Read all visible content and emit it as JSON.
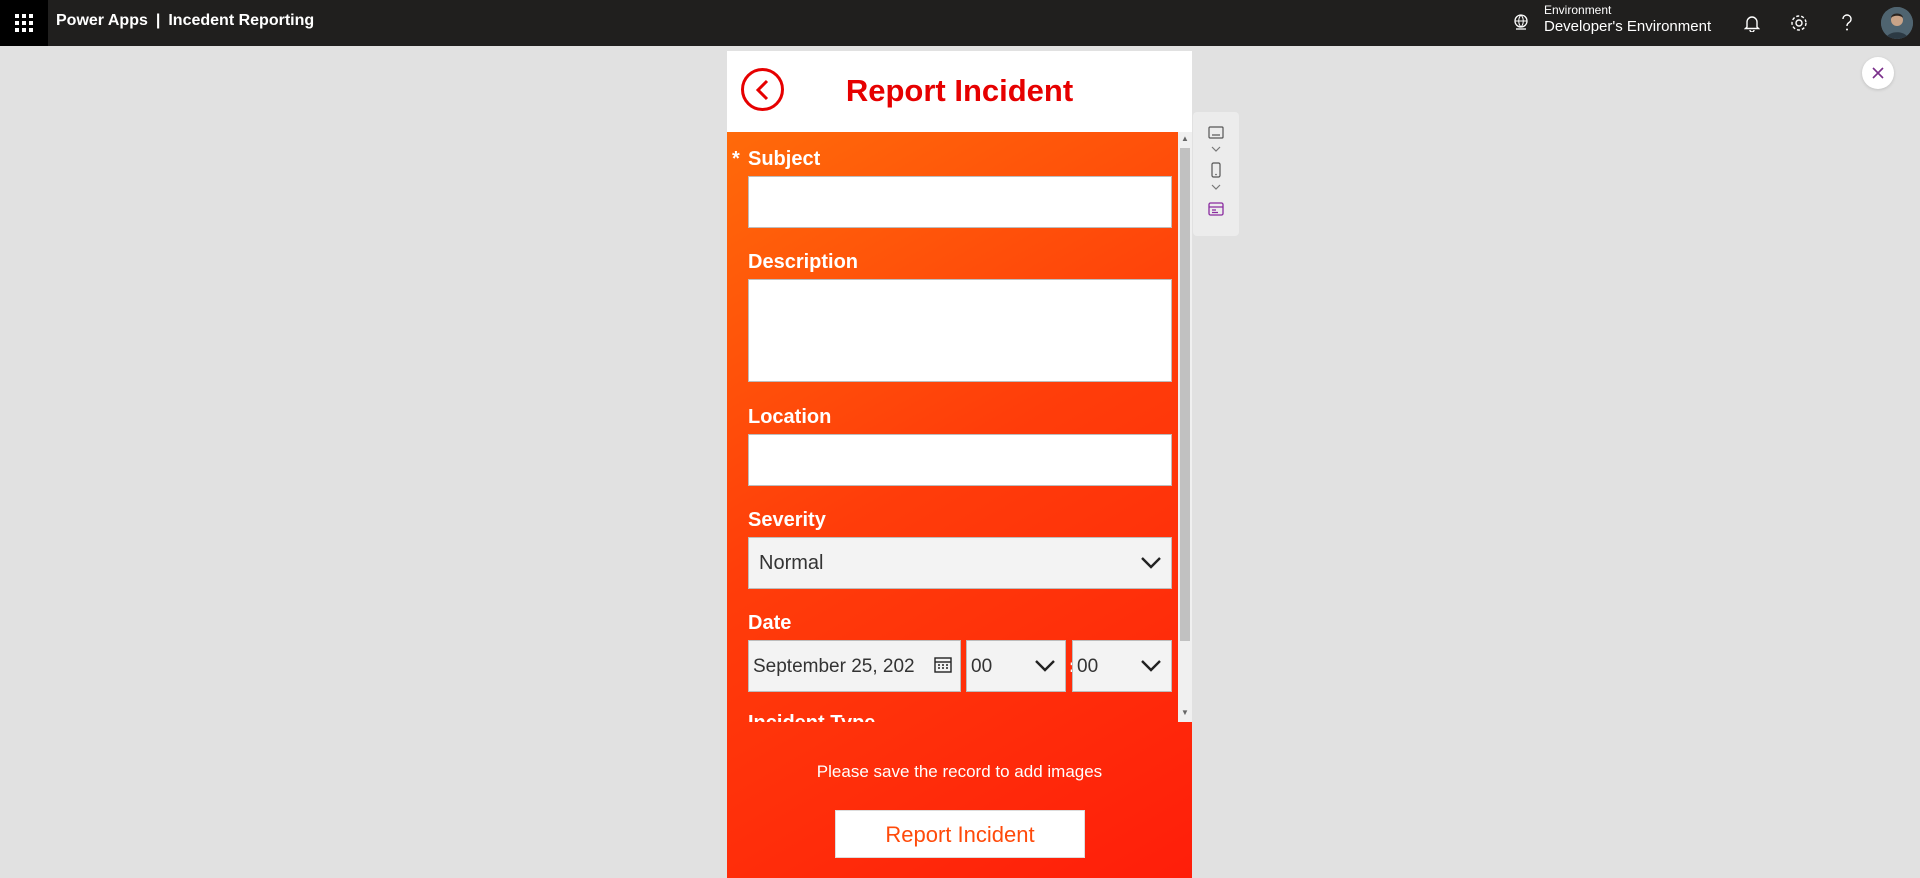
{
  "topbar": {
    "app_name": "Power Apps",
    "separator": "|",
    "app_title": "Incedent Reporting",
    "environment_label": "Environment",
    "environment_value": "Developer's Environment"
  },
  "phone": {
    "title": "Report Incident",
    "fields": {
      "required_marker": "*",
      "subject_label": "Subject",
      "subject_value": "",
      "description_label": "Description",
      "description_value": "",
      "location_label": "Location",
      "location_value": "",
      "severity_label": "Severity",
      "severity_value": "Normal",
      "date_label": "Date",
      "date_value": "September 25, 202",
      "hour_value": "00",
      "time_separator": ":",
      "minute_value": "00",
      "next_label_partial": "Incident Type"
    },
    "notice": "Please save the record to add images",
    "submit_label": "Report Incident"
  },
  "colors": {
    "brand_red": "#e60000",
    "topbar_bg": "#201f1e",
    "gradient_start": "#ff6a0a",
    "gradient_end": "#ff1e0a"
  },
  "icons": [
    "app-launcher-icon",
    "environment-icon",
    "bell-icon",
    "gear-icon",
    "help-icon",
    "avatar",
    "close-icon",
    "back-arrow-icon",
    "chevron-down-icon",
    "calendar-icon",
    "keyboard-icon",
    "phone-icon",
    "layout-icon"
  ]
}
